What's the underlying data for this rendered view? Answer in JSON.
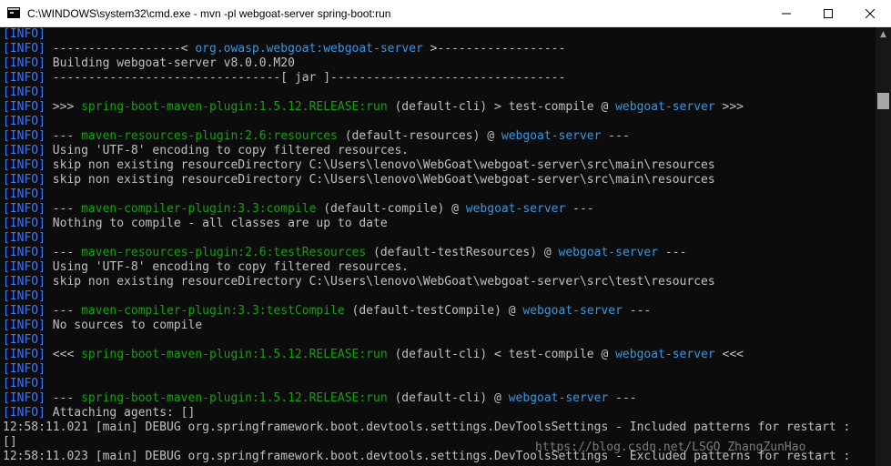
{
  "window": {
    "title": "C:\\WINDOWS\\system32\\cmd.exe - mvn  -pl webgoat-server spring-boot:run"
  },
  "colors": {
    "info": "#3b78ff",
    "green": "#13a10e",
    "cyan": "#3a96dd",
    "text": "#c0c0c0",
    "background": "#0c0c0c"
  },
  "console": {
    "lines": [
      [
        {
          "t": "[INFO]",
          "c": "info"
        }
      ],
      [
        {
          "t": "[INFO]",
          "c": "info"
        },
        {
          "t": " ------------------< ",
          "c": "plain"
        },
        {
          "t": "org.owasp.webgoat:webgoat-server",
          "c": "cyan"
        },
        {
          "t": " >------------------",
          "c": "plain"
        }
      ],
      [
        {
          "t": "[INFO]",
          "c": "info"
        },
        {
          "t": " Building webgoat-server v8.0.0.M20",
          "c": "plain"
        }
      ],
      [
        {
          "t": "[INFO]",
          "c": "info"
        },
        {
          "t": " --------------------------------[ jar ]---------------------------------",
          "c": "plain"
        }
      ],
      [
        {
          "t": "[INFO]",
          "c": "info"
        }
      ],
      [
        {
          "t": "[INFO]",
          "c": "info"
        },
        {
          "t": " >>> ",
          "c": "plain"
        },
        {
          "t": "spring-boot-maven-plugin:1.5.12.RELEASE:run",
          "c": "green"
        },
        {
          "t": " (default-cli) > test-compile @ ",
          "c": "plain"
        },
        {
          "t": "webgoat-server",
          "c": "cyan"
        },
        {
          "t": " >>>",
          "c": "plain"
        }
      ],
      [
        {
          "t": "[INFO]",
          "c": "info"
        }
      ],
      [
        {
          "t": "[INFO]",
          "c": "info"
        },
        {
          "t": " --- ",
          "c": "plain"
        },
        {
          "t": "maven-resources-plugin:2.6:resources",
          "c": "green"
        },
        {
          "t": " (default-resources) @ ",
          "c": "plain"
        },
        {
          "t": "webgoat-server",
          "c": "cyan"
        },
        {
          "t": " ---",
          "c": "plain"
        }
      ],
      [
        {
          "t": "[INFO]",
          "c": "info"
        },
        {
          "t": " Using 'UTF-8' encoding to copy filtered resources.",
          "c": "plain"
        }
      ],
      [
        {
          "t": "[INFO]",
          "c": "info"
        },
        {
          "t": " skip non existing resourceDirectory C:\\Users\\lenovo\\WebGoat\\webgoat-server\\src\\main\\resources",
          "c": "plain"
        }
      ],
      [
        {
          "t": "[INFO]",
          "c": "info"
        },
        {
          "t": " skip non existing resourceDirectory C:\\Users\\lenovo\\WebGoat\\webgoat-server\\src\\main\\resources",
          "c": "plain"
        }
      ],
      [
        {
          "t": "[INFO]",
          "c": "info"
        }
      ],
      [
        {
          "t": "[INFO]",
          "c": "info"
        },
        {
          "t": " --- ",
          "c": "plain"
        },
        {
          "t": "maven-compiler-plugin:3.3:compile",
          "c": "green"
        },
        {
          "t": " (default-compile) @ ",
          "c": "plain"
        },
        {
          "t": "webgoat-server",
          "c": "cyan"
        },
        {
          "t": " ---",
          "c": "plain"
        }
      ],
      [
        {
          "t": "[INFO]",
          "c": "info"
        },
        {
          "t": " Nothing to compile - all classes are up to date",
          "c": "plain"
        }
      ],
      [
        {
          "t": "[INFO]",
          "c": "info"
        }
      ],
      [
        {
          "t": "[INFO]",
          "c": "info"
        },
        {
          "t": " --- ",
          "c": "plain"
        },
        {
          "t": "maven-resources-plugin:2.6:testResources",
          "c": "green"
        },
        {
          "t": " (default-testResources) @ ",
          "c": "plain"
        },
        {
          "t": "webgoat-server",
          "c": "cyan"
        },
        {
          "t": " ---",
          "c": "plain"
        }
      ],
      [
        {
          "t": "[INFO]",
          "c": "info"
        },
        {
          "t": " Using 'UTF-8' encoding to copy filtered resources.",
          "c": "plain"
        }
      ],
      [
        {
          "t": "[INFO]",
          "c": "info"
        },
        {
          "t": " skip non existing resourceDirectory C:\\Users\\lenovo\\WebGoat\\webgoat-server\\src\\test\\resources",
          "c": "plain"
        }
      ],
      [
        {
          "t": "[INFO]",
          "c": "info"
        }
      ],
      [
        {
          "t": "[INFO]",
          "c": "info"
        },
        {
          "t": " --- ",
          "c": "plain"
        },
        {
          "t": "maven-compiler-plugin:3.3:testCompile",
          "c": "green"
        },
        {
          "t": " (default-testCompile) @ ",
          "c": "plain"
        },
        {
          "t": "webgoat-server",
          "c": "cyan"
        },
        {
          "t": " ---",
          "c": "plain"
        }
      ],
      [
        {
          "t": "[INFO]",
          "c": "info"
        },
        {
          "t": " No sources to compile",
          "c": "plain"
        }
      ],
      [
        {
          "t": "[INFO]",
          "c": "info"
        }
      ],
      [
        {
          "t": "[INFO]",
          "c": "info"
        },
        {
          "t": " <<< ",
          "c": "plain"
        },
        {
          "t": "spring-boot-maven-plugin:1.5.12.RELEASE:run",
          "c": "green"
        },
        {
          "t": " (default-cli) < test-compile @ ",
          "c": "plain"
        },
        {
          "t": "webgoat-server",
          "c": "cyan"
        },
        {
          "t": " <<<",
          "c": "plain"
        }
      ],
      [
        {
          "t": "[INFO]",
          "c": "info"
        }
      ],
      [
        {
          "t": "[INFO]",
          "c": "info"
        }
      ],
      [
        {
          "t": "[INFO]",
          "c": "info"
        },
        {
          "t": " --- ",
          "c": "plain"
        },
        {
          "t": "spring-boot-maven-plugin:1.5.12.RELEASE:run",
          "c": "green"
        },
        {
          "t": " (default-cli) @ ",
          "c": "plain"
        },
        {
          "t": "webgoat-server",
          "c": "cyan"
        },
        {
          "t": " ---",
          "c": "plain"
        }
      ],
      [
        {
          "t": "[INFO]",
          "c": "info"
        },
        {
          "t": " Attaching agents: []",
          "c": "plain"
        }
      ],
      [
        {
          "t": "12:58:11.021 [main] DEBUG org.springframework.boot.devtools.settings.DevToolsSettings - Included patterns for restart :",
          "c": "plain"
        }
      ],
      [
        {
          "t": "[]",
          "c": "plain"
        }
      ],
      [
        {
          "t": "12:58:11.023 [main] DEBUG org.springframework.boot.devtools.settings.DevToolsSettings - Excluded patterns for restart :",
          "c": "plain"
        }
      ]
    ]
  },
  "watermark": {
    "text": "https://blog.csdn.net/LSGO_ZhangZunHao"
  },
  "icons": {
    "app": "console-app-icon",
    "minimize": "minimize-icon",
    "maximize": "maximize-icon",
    "close": "close-icon",
    "scroll_up": "scroll-up-arrow-icon"
  }
}
